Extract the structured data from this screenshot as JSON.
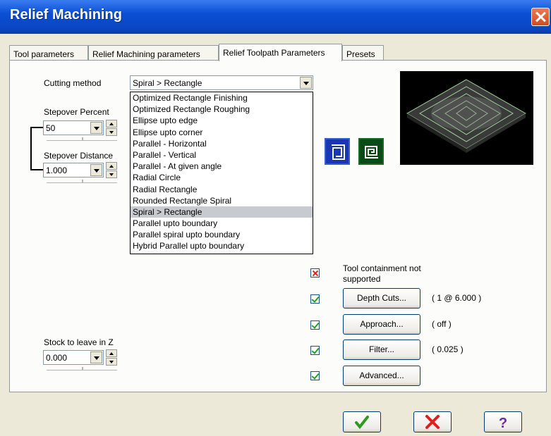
{
  "window": {
    "title": "Relief Machining"
  },
  "tabs": [
    {
      "label": "Tool parameters"
    },
    {
      "label": "Relief Machining parameters"
    },
    {
      "label": "Relief Toolpath Parameters"
    },
    {
      "label": "Presets"
    }
  ],
  "cutting": {
    "label": "Cutting method",
    "value": "Spiral > Rectangle",
    "options": [
      "Optimized Rectangle Finishing",
      "Optimized Rectangle Roughing",
      "Ellipse upto edge",
      "Ellipse upto corner",
      "Parallel - Horizontal",
      "Parallel - Vertical",
      "Parallel - At given angle",
      "Radial Circle",
      "Radial Rectangle",
      "Rounded Rectangle Spiral",
      "Spiral > Rectangle",
      "Parallel upto boundary",
      "Parallel spiral upto boundary",
      "Hybrid Parallel upto boundary"
    ]
  },
  "stepover_percent": {
    "label": "Stepover Percent",
    "value": "50"
  },
  "stepover_distance": {
    "label": "Stepover Distance",
    "value": "1.000"
  },
  "stock": {
    "label": "Stock to leave in Z",
    "value": "0.000"
  },
  "tool_containment": {
    "label": "Tool containment not supported"
  },
  "options": {
    "depth_cuts": {
      "label": "Depth Cuts...",
      "value": "( 1 @ 6.000 )"
    },
    "approach": {
      "label": "Approach...",
      "value": "( off )"
    },
    "filter": {
      "label": "Filter...",
      "value": "( 0.025 )"
    },
    "advanced": {
      "label": "Advanced..."
    }
  },
  "colors": {
    "title_bar": "#0a4fd6",
    "ok": "#2e9b1e",
    "cancel": "#e01e1e",
    "help": "#6b2ca0"
  },
  "icons": {
    "ok": "check-icon",
    "cancel": "x-icon",
    "help": "question-icon"
  }
}
